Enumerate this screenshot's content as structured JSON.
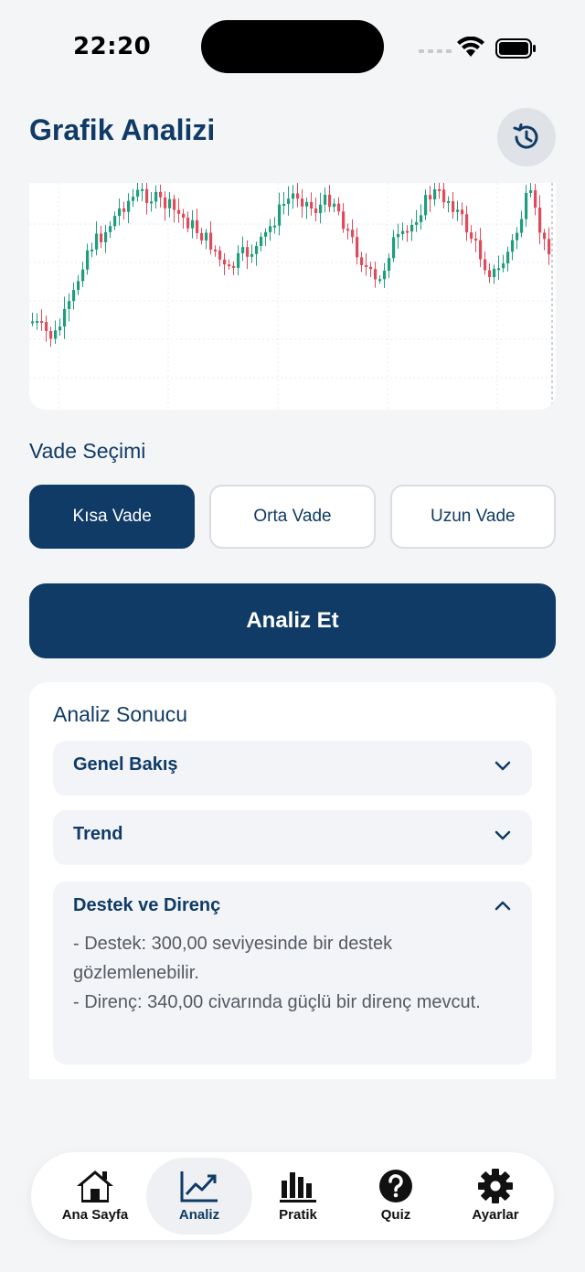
{
  "status_bar": {
    "time": "22:20"
  },
  "header": {
    "title": "Grafik Analizi",
    "history_icon": "history-icon"
  },
  "chart": {
    "type": "candlestick",
    "up_color": "#1f9e7e",
    "down_color": "#e04b5b"
  },
  "term": {
    "title": "Vade Seçimi",
    "options": [
      "Kısa Vade",
      "Orta Vade",
      "Uzun Vade"
    ],
    "selected": "Kısa Vade"
  },
  "analyze": {
    "label": "Analiz Et"
  },
  "result": {
    "title": "Analiz Sonucu",
    "sections": [
      {
        "label": "Genel Bakış",
        "expanded": false
      },
      {
        "label": "Trend",
        "expanded": false
      },
      {
        "label": "Destek ve Direnç",
        "expanded": true,
        "body_line1": "- Destek: 300,00 seviyesinde bir destek gözlemlenebilir.",
        "body_line2": "- Direnç: 340,00 civarında güçlü bir direnç mevcut."
      }
    ]
  },
  "nav": {
    "items": [
      {
        "label": "Ana Sayfa",
        "icon": "home-icon"
      },
      {
        "label": "Analiz",
        "icon": "chart-icon"
      },
      {
        "label": "Pratik",
        "icon": "bar-chart-icon"
      },
      {
        "label": "Quiz",
        "icon": "question-icon"
      },
      {
        "label": "Ayarlar",
        "icon": "gear-icon"
      }
    ],
    "active": "Analiz"
  },
  "colors": {
    "primary": "#0f3b66",
    "background": "#f4f5f7"
  }
}
